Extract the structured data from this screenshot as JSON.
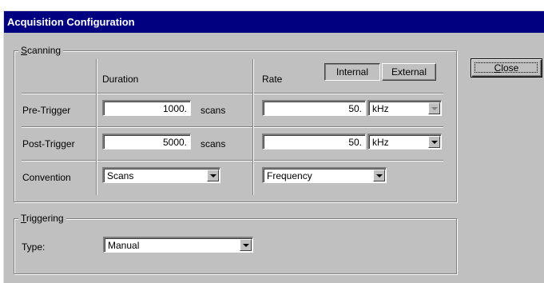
{
  "window": {
    "title": "Acquisition Configuration"
  },
  "scanning": {
    "group_label_ul": "S",
    "group_label_rest": "canning",
    "duration_header": "Duration",
    "rate_header": "Rate",
    "internal_label": "Internal",
    "external_label": "External",
    "pre_trigger": {
      "label": "Pre-Trigger",
      "duration": "1000.",
      "duration_unit": "scans",
      "rate": "50.",
      "rate_unit": "kHz"
    },
    "post_trigger": {
      "label": "Post-Trigger",
      "duration": "5000.",
      "duration_unit": "scans",
      "rate": "50.",
      "rate_unit": "kHz"
    },
    "convention": {
      "label": "Convention",
      "duration_value": "Scans",
      "rate_value": "Frequency"
    }
  },
  "triggering": {
    "group_label_ul": "T",
    "group_label_rest": "riggering",
    "type_label": "Type:",
    "type_value": "Manual"
  },
  "close_button": {
    "label_ul": "C",
    "label_rest": "lose"
  }
}
